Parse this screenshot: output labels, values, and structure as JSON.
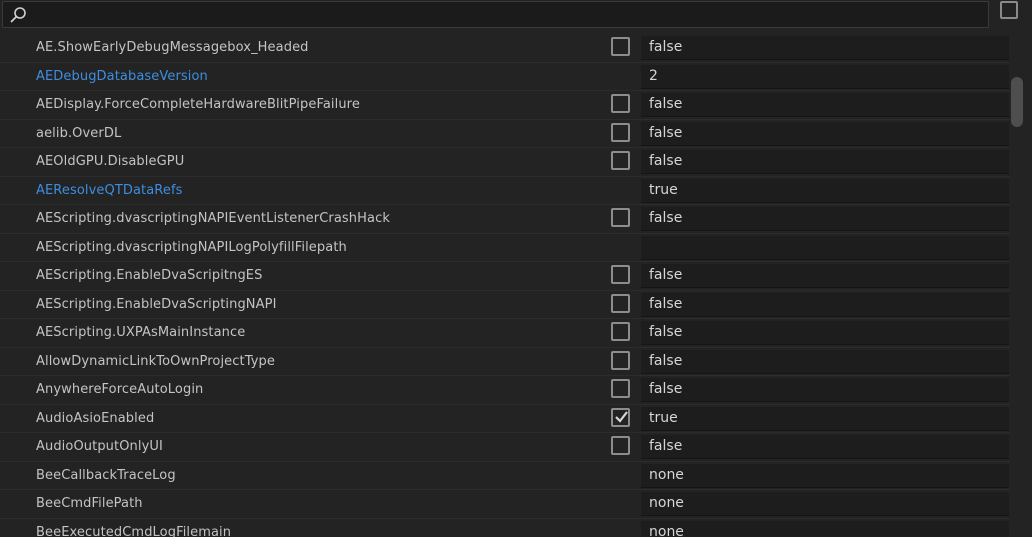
{
  "search": {
    "placeholder": "",
    "value": ""
  },
  "rows": [
    {
      "name": "AE.ShowEarlyDebugMessagebox_Headed",
      "link": false,
      "checkbox": "unchecked",
      "value": "false"
    },
    {
      "name": "AEDebugDatabaseVersion",
      "link": true,
      "checkbox": "none",
      "value": "2"
    },
    {
      "name": "AEDisplay.ForceCompleteHardwareBlitPipeFailure",
      "link": false,
      "checkbox": "unchecked",
      "value": "false"
    },
    {
      "name": "aelib.OverDL",
      "link": false,
      "checkbox": "unchecked",
      "value": "false"
    },
    {
      "name": "AEOldGPU.DisableGPU",
      "link": false,
      "checkbox": "unchecked",
      "value": "false"
    },
    {
      "name": "AEResolveQTDataRefs",
      "link": true,
      "checkbox": "none",
      "value": "true"
    },
    {
      "name": "AEScripting.dvascriptingNAPIEventListenerCrashHack",
      "link": false,
      "checkbox": "unchecked",
      "value": "false"
    },
    {
      "name": "AEScripting.dvascriptingNAPILogPolyfillFilepath",
      "link": false,
      "checkbox": "none",
      "value": ""
    },
    {
      "name": "AEScripting.EnableDvaScripitngES",
      "link": false,
      "checkbox": "unchecked",
      "value": "false"
    },
    {
      "name": "AEScripting.EnableDvaScriptingNAPI",
      "link": false,
      "checkbox": "unchecked",
      "value": "false"
    },
    {
      "name": "AEScripting.UXPAsMainInstance",
      "link": false,
      "checkbox": "unchecked",
      "value": "false"
    },
    {
      "name": "AllowDynamicLinkToOwnProjectType",
      "link": false,
      "checkbox": "unchecked",
      "value": "false"
    },
    {
      "name": "AnywhereForceAutoLogin",
      "link": false,
      "checkbox": "unchecked",
      "value": "false"
    },
    {
      "name": "AudioAsioEnabled",
      "link": false,
      "checkbox": "checked",
      "value": "true"
    },
    {
      "name": "AudioOutputOnlyUI",
      "link": false,
      "checkbox": "unchecked",
      "value": "false"
    },
    {
      "name": "BeeCallbackTraceLog",
      "link": false,
      "checkbox": "none",
      "value": "none"
    },
    {
      "name": "BeeCmdFilePath",
      "link": false,
      "checkbox": "none",
      "value": "none"
    },
    {
      "name": "BeeExecutedCmdLogFilemain",
      "link": false,
      "checkbox": "none",
      "value": "none"
    }
  ],
  "colors": {
    "background": "#232323",
    "link": "#3d8ee0",
    "text": "#c4c4c4",
    "value_field": "#1d1d1d"
  },
  "icons": {
    "search": "search-icon",
    "checkbox_checked": "checkmark-icon"
  }
}
